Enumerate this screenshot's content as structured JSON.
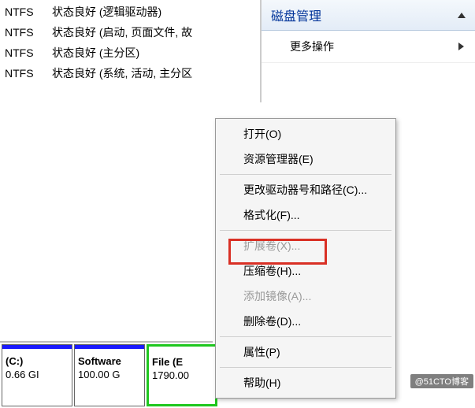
{
  "volumes": [
    {
      "fs": "NTFS",
      "status": "状态良好 (逻辑驱动器)"
    },
    {
      "fs": "NTFS",
      "status": "状态良好 (启动, 页面文件, 故"
    },
    {
      "fs": "NTFS",
      "status": "状态良好 (主分区)"
    },
    {
      "fs": "NTFS",
      "status": "状态良好 (系统, 活动, 主分区"
    }
  ],
  "rightPanel": {
    "title": "磁盘管理",
    "moreActions": "更多操作"
  },
  "diskBlocks": [
    {
      "name": "(C:)",
      "size": "0.66 GI"
    },
    {
      "name": "Software",
      "size": "100.00 G"
    },
    {
      "name": "File  (E",
      "size": "1790.00"
    }
  ],
  "contextMenu": {
    "open": "打开(O)",
    "explorer": "资源管理器(E)",
    "changeLetter": "更改驱动器号和路径(C)...",
    "format": "格式化(F)...",
    "extend": "扩展卷(X)...",
    "shrink": "压缩卷(H)...",
    "addMirror": "添加镜像(A)...",
    "delete": "删除卷(D)...",
    "properties": "属性(P)",
    "help": "帮助(H)"
  },
  "watermark": "@51CTO博客"
}
